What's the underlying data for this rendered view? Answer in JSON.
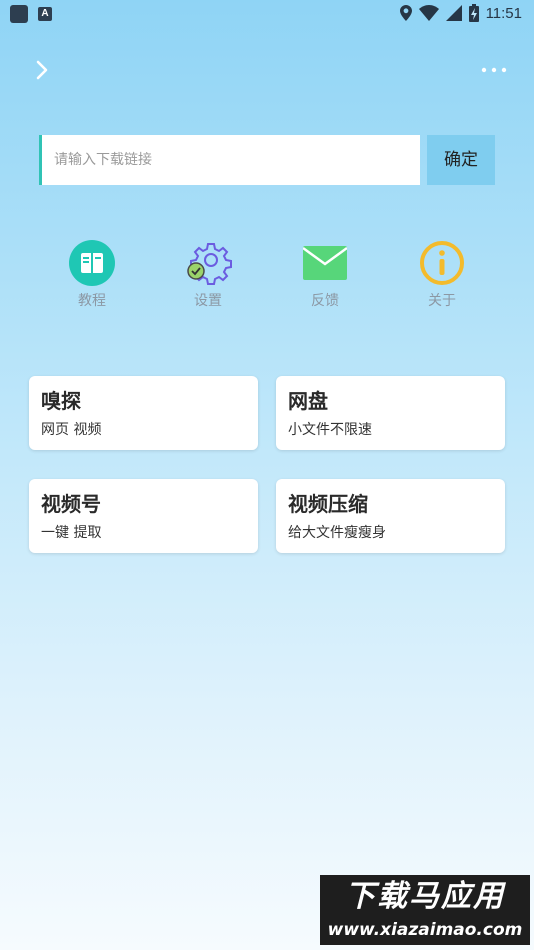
{
  "status_bar": {
    "time": "11:51",
    "notif_icon_2": "A"
  },
  "search": {
    "placeholder": "请输入下载链接",
    "value": "",
    "confirm_label": "确定"
  },
  "tools": [
    {
      "label": "教程",
      "icon": "book-icon",
      "color": "#1fc7b4"
    },
    {
      "label": "设置",
      "icon": "gear-icon",
      "color": "#6b5ce0"
    },
    {
      "label": "反馈",
      "icon": "mail-icon",
      "color": "#57d67a"
    },
    {
      "label": "关于",
      "icon": "info-icon",
      "color": "#f3bb2c"
    }
  ],
  "cards": [
    {
      "title": "嗅探",
      "subtitle": "网页 视频"
    },
    {
      "title": "网盘",
      "subtitle": "小文件不限速"
    },
    {
      "title": "视频号",
      "subtitle": "一键 提取"
    },
    {
      "title": "视频压缩",
      "subtitle": "给大文件瘦瘦身"
    }
  ],
  "watermark": {
    "title": "下载马应用",
    "url": "www.xiazaimao.com"
  }
}
